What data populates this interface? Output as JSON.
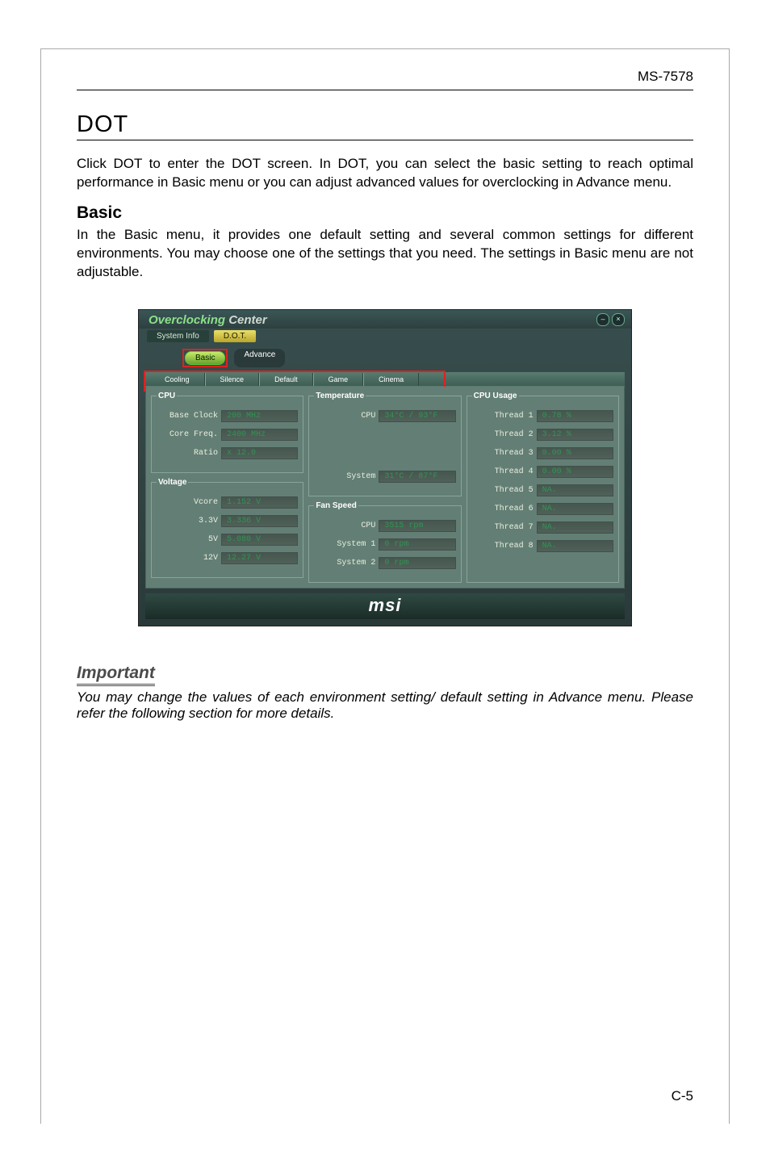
{
  "header": {
    "model_id": "MS-7578"
  },
  "section": {
    "title": "DOT",
    "intro": "Click DOT to enter the DOT screen. In DOT, you can select the basic setting to reach optimal performance in Basic menu or you can adjust advanced values for overclocking in Advance menu.",
    "sub_title": "Basic",
    "sub_text": "In the Basic menu, it provides one default setting and several common settings for different environments. You may choose one of the settings that you need. The settings in Basic menu are not adjustable."
  },
  "shot": {
    "window_title_a": "Overclocking",
    "window_title_b": "Center",
    "top_tabs": {
      "system_info": "System Info",
      "dot": "D.O.T."
    },
    "sub_tabs": {
      "basic": "Basic",
      "advance": "Advance"
    },
    "env": [
      "Cooling",
      "Silence",
      "Default",
      "Game",
      "Cinema"
    ],
    "groups": {
      "cpu": {
        "title": "CPU",
        "rows": [
          {
            "label": "Base Clock",
            "value": "200 MHz"
          },
          {
            "label": "Core Freq.",
            "value": "2400 MHz"
          },
          {
            "label": "Ratio",
            "value": "x 12.0"
          }
        ]
      },
      "voltage": {
        "title": "Voltage",
        "rows": [
          {
            "label": "Vcore",
            "value": "1.152 V"
          },
          {
            "label": "3.3V",
            "value": "3.336 V"
          },
          {
            "label": "5V",
            "value": "5.080 V"
          },
          {
            "label": "12V",
            "value": "12.27 V"
          }
        ]
      },
      "temperature": {
        "title": "Temperature",
        "rows": [
          {
            "label": "CPU",
            "value": "34°C / 93°F"
          },
          {
            "label": "System",
            "value": "31°C / 87°F"
          }
        ]
      },
      "fan": {
        "title": "Fan Speed",
        "rows": [
          {
            "label": "CPU",
            "value": "3515 rpm"
          },
          {
            "label": "System 1",
            "value": "0 rpm"
          },
          {
            "label": "System 2",
            "value": "0 rpm"
          }
        ]
      },
      "usage": {
        "title": "CPU Usage",
        "rows": [
          {
            "label": "Thread 1",
            "value": "0.78 %"
          },
          {
            "label": "Thread 2",
            "value": "3.12 %"
          },
          {
            "label": "Thread 3",
            "value": "0.00 %"
          },
          {
            "label": "Thread 4",
            "value": "0.00 %"
          },
          {
            "label": "Thread 5",
            "value": "NA."
          },
          {
            "label": "Thread 6",
            "value": "NA."
          },
          {
            "label": "Thread 7",
            "value": "NA."
          },
          {
            "label": "Thread 8",
            "value": "NA."
          }
        ]
      }
    },
    "brand": "msi"
  },
  "important": {
    "label": "Important",
    "text": "You may change the values of each environment setting/ default setting in Advance menu. Please refer the following section for more details."
  },
  "footer": {
    "page": "C-5"
  }
}
